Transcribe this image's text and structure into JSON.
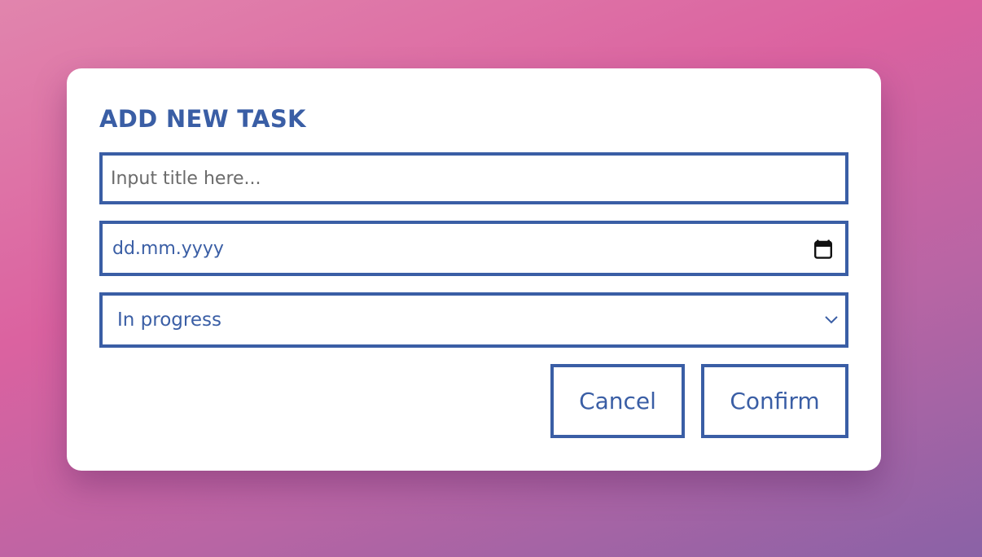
{
  "dialog": {
    "title": "ADD NEW TASK"
  },
  "form": {
    "title_input": {
      "placeholder": "Input title here...",
      "value": ""
    },
    "date_input": {
      "placeholder": "dd.mm.yyyy",
      "icon": "calendar-icon"
    },
    "status_select": {
      "selected": "In progress",
      "icon": "chevron-down-icon"
    }
  },
  "actions": {
    "cancel_label": "Cancel",
    "confirm_label": "Confirm"
  },
  "colors": {
    "accent": "#3a5ea5",
    "background_start": "#e185ad",
    "background_end": "#8a62a6",
    "dialog_bg": "#ffffff"
  }
}
